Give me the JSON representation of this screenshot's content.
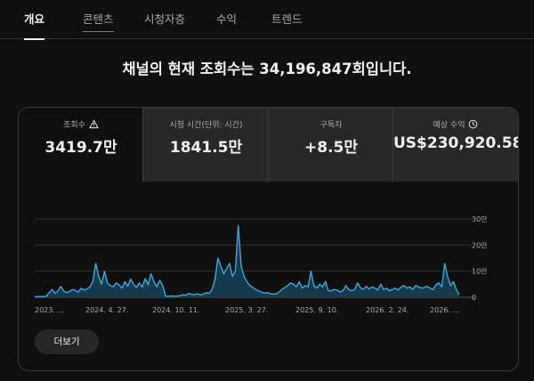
{
  "tabs": [
    {
      "label": "개요",
      "active": true
    },
    {
      "label": "콘텐츠",
      "active": false
    },
    {
      "label": "시청자층",
      "active": false
    },
    {
      "label": "수익",
      "active": false
    },
    {
      "label": "트렌드",
      "active": false
    }
  ],
  "headline": "채널의 현재 조회수는 34,196,847회입니다.",
  "metrics": [
    {
      "label": "조회수",
      "value": "3419.7만",
      "icon": "warning-icon"
    },
    {
      "label": "시청 시간(단위: 시간)",
      "value": "1841.5만",
      "icon": ""
    },
    {
      "label": "구독자",
      "value": "+8.5만",
      "icon": ""
    },
    {
      "label": "예상 수익",
      "value": "US$230,920.58",
      "icon": "clock-icon"
    }
  ],
  "colors": {
    "line": "#3ea6d9",
    "area": "#163a4d",
    "background": "#0f0f0f",
    "panel": "#282828"
  },
  "chart_data": {
    "type": "area",
    "x_ticks": [
      "2023. …",
      "2024. 4. 27.",
      "2024. 10. 11.",
      "2025. 3. 27.",
      "2025. 9. 10.",
      "2026. 2. 24.",
      "2026. …"
    ],
    "y_ticks": [
      "30만",
      "20만",
      "10만",
      "0"
    ],
    "ylim": [
      0,
      300000
    ],
    "grid": true,
    "series": [
      {
        "values": [
          2000,
          3000,
          2500,
          3000,
          4000,
          18000,
          30000,
          15000,
          25000,
          42000,
          24000,
          18000,
          22000,
          30000,
          26000,
          20000,
          35000,
          28000,
          32000,
          40000,
          60000,
          130000,
          80000,
          50000,
          100000,
          55000,
          45000,
          40000,
          55000,
          48000,
          35000,
          60000,
          42000,
          70000,
          50000,
          38000,
          55000,
          40000,
          72000,
          48000,
          90000,
          60000,
          40000,
          65000,
          45000,
          5000,
          4000,
          5000,
          4500,
          5000,
          6000,
          10000,
          8000,
          15000,
          12000,
          10000,
          14000,
          9000,
          12000,
          18000,
          15000,
          30000,
          70000,
          150000,
          120000,
          90000,
          110000,
          130000,
          80000,
          100000,
          275000,
          120000,
          80000,
          60000,
          45000,
          38000,
          30000,
          25000,
          20000,
          16000,
          18000,
          14000,
          12000,
          13000,
          20000,
          30000,
          38000,
          45000,
          55000,
          50000,
          40000,
          60000,
          35000,
          45000,
          40000,
          100000,
          45000,
          35000,
          50000,
          40000,
          60000,
          25000,
          25000,
          30000,
          28000,
          20000,
          25000,
          45000,
          30000,
          25000,
          30000,
          55000,
          38000,
          30000,
          42000,
          32000,
          40000,
          35000,
          28000,
          50000,
          30000,
          35000,
          25000,
          30000,
          35000,
          28000,
          40000,
          45000,
          35000,
          40000,
          30000,
          45000,
          40000,
          35000,
          38000,
          42000,
          35000,
          30000,
          48000,
          55000,
          40000,
          130000,
          80000,
          45000,
          60000,
          30000,
          10000
        ]
      }
    ]
  },
  "more_button": {
    "label": "더보기"
  }
}
